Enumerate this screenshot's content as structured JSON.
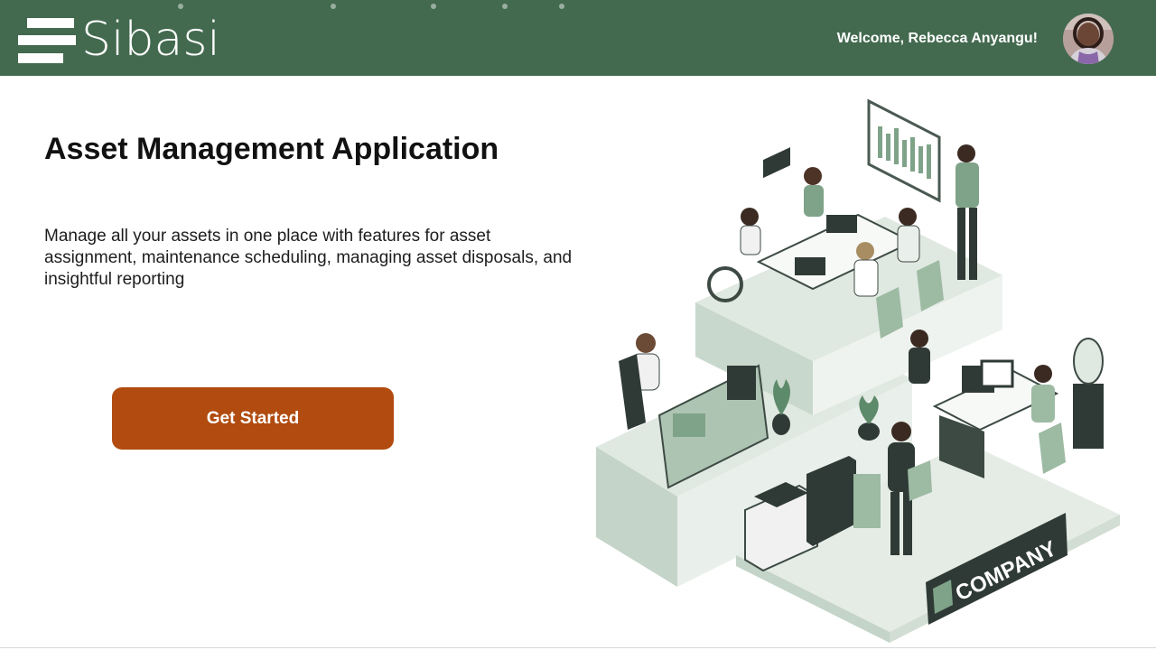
{
  "app": {
    "brand_name": "Sibasi",
    "logo_icon": "stacked-bars-logo"
  },
  "header": {
    "welcome_text": "Welcome, Rebecca Anyangu!",
    "avatar_icon": "user-avatar"
  },
  "hero": {
    "title": "Asset Management Application",
    "description": "Manage all your assets in one place with features for asset assignment, maintenance scheduling, managing asset disposals, and insightful reporting",
    "cta_label": "Get Started"
  },
  "illustration": {
    "sign_text": "COMPANY",
    "icon": "office-team-illustration"
  },
  "colors": {
    "header_bg": "#436a4f",
    "cta_bg": "#b14b0f",
    "illustration_green": "#8fae96"
  }
}
